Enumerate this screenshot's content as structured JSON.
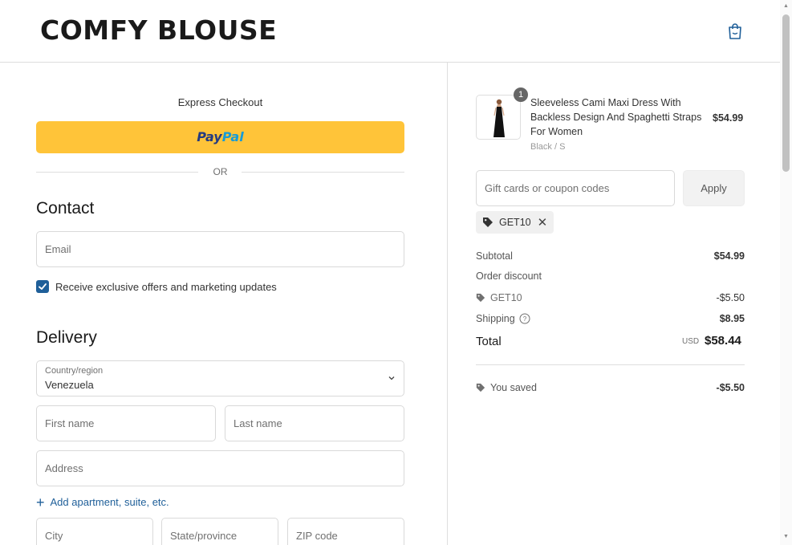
{
  "header": {
    "logo": "COMFY BLOUSE",
    "cart_icon": "shopping-bag-icon"
  },
  "express": {
    "title": "Express Checkout",
    "paypal_pay": "Pay",
    "paypal_pal": "Pal",
    "or_label": "OR"
  },
  "contact": {
    "title": "Contact",
    "email_placeholder": "Email",
    "marketing_label": "Receive exclusive offers and marketing updates",
    "marketing_checked": true
  },
  "delivery": {
    "title": "Delivery",
    "country_label": "Country/region",
    "country_value": "Venezuela",
    "first_name_placeholder": "First name",
    "last_name_placeholder": "Last name",
    "address_placeholder": "Address",
    "add_apartment_label": "Add apartment, suite, etc.",
    "city_placeholder": "City",
    "state_placeholder": "State/province",
    "zip_placeholder": "ZIP code"
  },
  "order": {
    "product": {
      "name": "Sleeveless Cami Maxi Dress With Backless Design And Spaghetti Straps For Women",
      "variant": "Black / S",
      "price": "$54.99",
      "quantity": "1"
    },
    "coupon": {
      "placeholder": "Gift cards or coupon codes",
      "apply_label": "Apply",
      "applied_code": "GET10"
    },
    "summary": {
      "subtotal_label": "Subtotal",
      "subtotal_value": "$54.99",
      "order_discount_label": "Order discount",
      "discount_code": "GET10",
      "discount_value": "-$5.50",
      "shipping_label": "Shipping",
      "shipping_value": "$8.95",
      "total_label": "Total",
      "total_currency": "USD",
      "total_value": "$58.44",
      "saved_label": "You saved",
      "saved_value": "-$5.50"
    }
  },
  "colors": {
    "accent": "#1f5f99",
    "paypal_yellow": "#ffc439",
    "paypal_dark": "#253b80",
    "paypal_light": "#179bd7"
  }
}
